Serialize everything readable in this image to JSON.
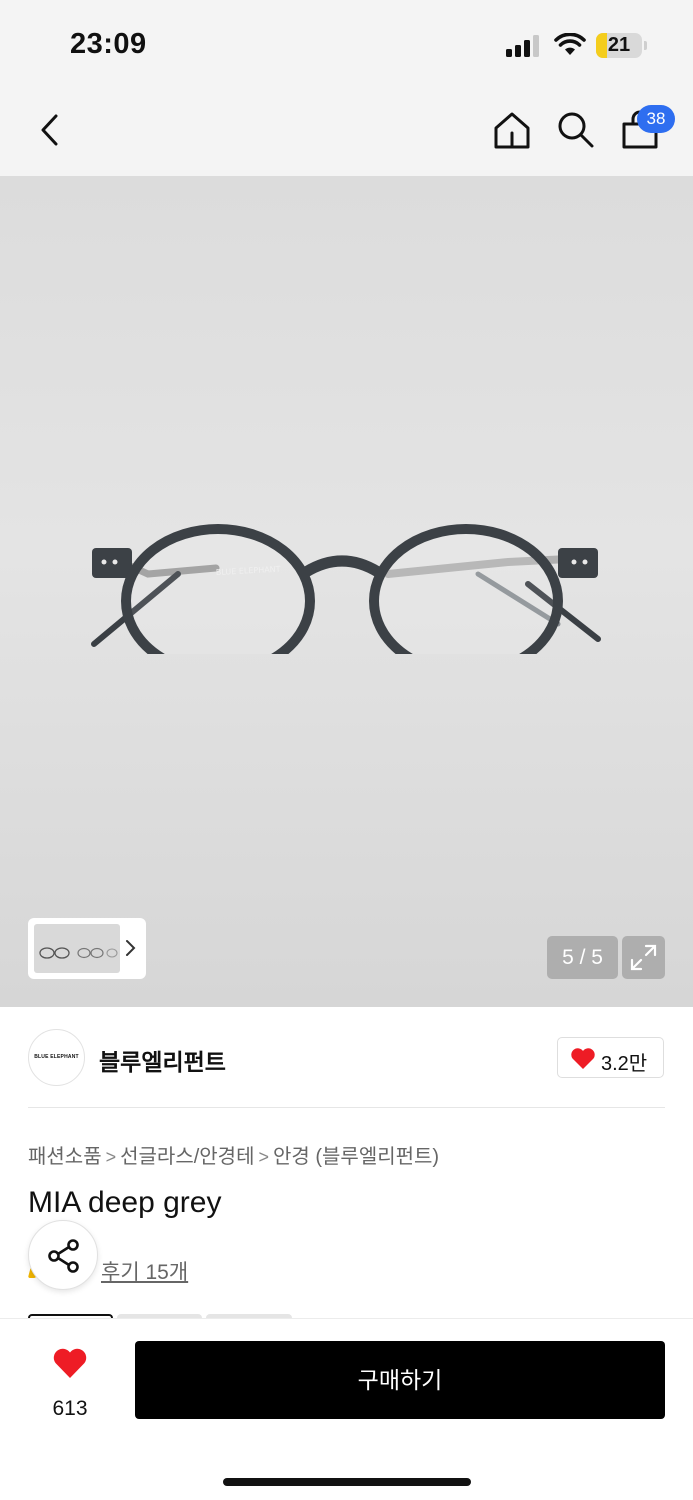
{
  "status_bar": {
    "time": "23:09",
    "battery_level": "21",
    "icons": [
      "signal-icon",
      "wifi-icon",
      "battery-icon"
    ]
  },
  "nav": {
    "icons": [
      "back-arrow-icon",
      "home-icon",
      "search-icon",
      "cart-icon"
    ],
    "cart_count": "38"
  },
  "gallery": {
    "product_logo_text": "BLUE ELEPHANT",
    "page_indicator": "5 / 5",
    "icons": [
      "chevron-right-icon",
      "expand-icon"
    ]
  },
  "brand": {
    "logo_text": "BLUE ELEPHANT",
    "name": "블루엘리펀트",
    "like_count": "3.2만"
  },
  "breadcrumb": {
    "items": [
      "패션소품",
      "선글라스/안경테",
      "안경 (블루엘리펀트)"
    ],
    "separator": ">"
  },
  "product": {
    "title": "MIA deep grey",
    "review_link": "후기 15개"
  },
  "bottom_bar": {
    "wish_count": "613",
    "buy_label": "구매하기"
  },
  "colors": {
    "accent": "#2e6ef0",
    "heart": "#ee1c25",
    "buy_button": "#000000",
    "battery": "#f4cd1d"
  }
}
